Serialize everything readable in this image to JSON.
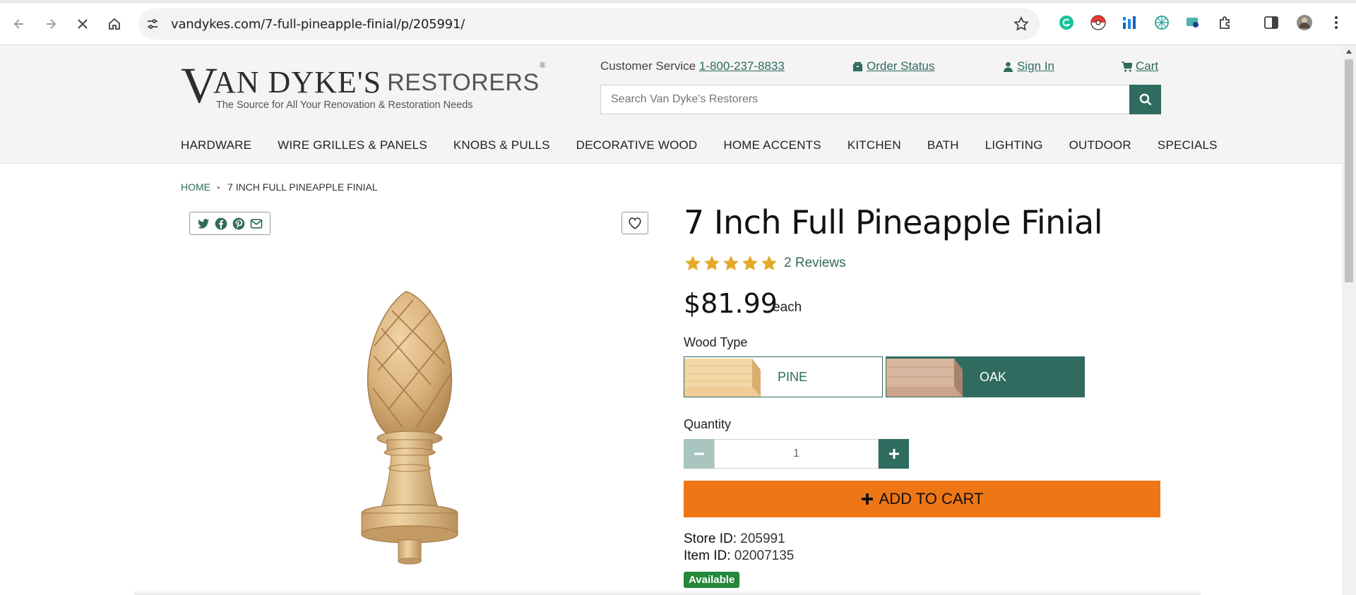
{
  "browser": {
    "url": "vandykes.com/7-full-pineapple-finial/p/205991/"
  },
  "header": {
    "logo_v": "V",
    "logo_name": "AN DYKE'S",
    "logo_restorers": "RESTORERS",
    "logo_reg": "®",
    "logo_tagline": "The Source for All Your Renovation & Restoration Needs",
    "customer_service_label": "Customer Service",
    "customer_service_phone": "1-800-237-8833",
    "order_status": "Order Status",
    "sign_in": "Sign In",
    "cart": "Cart",
    "search_placeholder": "Search Van Dyke's Restorers"
  },
  "categories": [
    "HARDWARE",
    "WIRE GRILLES & PANELS",
    "KNOBS & PULLS",
    "DECORATIVE WOOD",
    "HOME ACCENTS",
    "KITCHEN",
    "BATH",
    "LIGHTING",
    "OUTDOOR",
    "SPECIALS"
  ],
  "breadcrumb": {
    "home": "HOME",
    "separator": "▸",
    "current": "7 INCH FULL PINEAPPLE FINIAL"
  },
  "product": {
    "title": "7 Inch Full Pineapple Finial",
    "rating": 5,
    "rating_max": 5,
    "reviews": "2 Reviews",
    "price": "$81.99",
    "price_unit": "each",
    "wood_type_label": "Wood Type",
    "wood_options": [
      {
        "label": "PINE",
        "selected": false
      },
      {
        "label": "OAK",
        "selected": true
      }
    ],
    "quantity_label": "Quantity",
    "quantity": "1",
    "add_to_cart": "ADD TO CART",
    "store_id_label": "Store ID:",
    "store_id": "205991",
    "item_id_label": "Item ID:",
    "item_id": "02007135",
    "availability": "Available"
  },
  "colors": {
    "brand_green": "#2f6b5e",
    "cart_orange": "#ef7615",
    "star_gold": "#e3a928",
    "available_green": "#24873a"
  },
  "icons": {
    "share": [
      "twitter-icon",
      "facebook-icon",
      "pinterest-icon",
      "email-icon"
    ],
    "favorite": "heart-icon"
  }
}
